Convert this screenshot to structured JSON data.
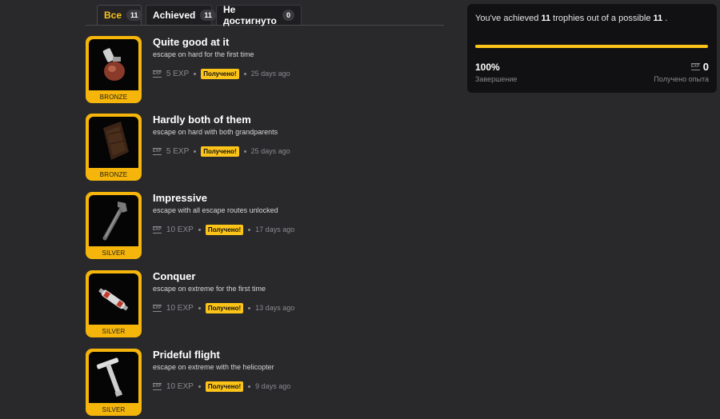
{
  "tabs": [
    {
      "label": "Все",
      "count": "11",
      "active": true
    },
    {
      "label": "Achieved",
      "count": "11",
      "active": false
    },
    {
      "label": "Не достигнуто",
      "count": "0",
      "active": false
    }
  ],
  "trophies": [
    {
      "title": "Quite good at it",
      "description": "escape on hard for the first time",
      "tier": "BRONZE",
      "exp": "5 EXP",
      "badge": "Получено!",
      "ago": "25 days ago",
      "icon": "grenade-icon"
    },
    {
      "title": "Hardly both of them",
      "description": "escape on hard with both grandparents",
      "tier": "BRONZE",
      "exp": "5 EXP",
      "badge": "Получено!",
      "ago": "25 days ago",
      "icon": "wooden-plank-icon"
    },
    {
      "title": "Impressive",
      "description": "escape with all escape routes unlocked",
      "tier": "SILVER",
      "exp": "10 EXP",
      "badge": "Получено!",
      "ago": "17 days ago",
      "icon": "wrench-icon"
    },
    {
      "title": "Conquer",
      "description": "escape on extreme for the first time",
      "tier": "SILVER",
      "exp": "10 EXP",
      "badge": "Получено!",
      "ago": "13 days ago",
      "icon": "fuse-icon"
    },
    {
      "title": "Prideful flight",
      "description": "escape on extreme with the helicopter",
      "tier": "SILVER",
      "exp": "10 EXP",
      "badge": "Получено!",
      "ago": "9 days ago",
      "icon": "t-wrench-icon"
    }
  ],
  "exp_icon_text": "EXP",
  "summary": {
    "prefix": "You've achieved",
    "achieved": "11",
    "middle": "trophies out of a possible",
    "total": "11",
    "suffix": ".",
    "progress_fraction": 1.0,
    "percent": "100%",
    "percent_label": "Завершение",
    "exp_total": "0",
    "exp_label": "Получено опыта"
  },
  "colors": {
    "accent": "#fcc419",
    "frame": "#f5b50a",
    "background": "#29292c",
    "panel": "#111113"
  }
}
